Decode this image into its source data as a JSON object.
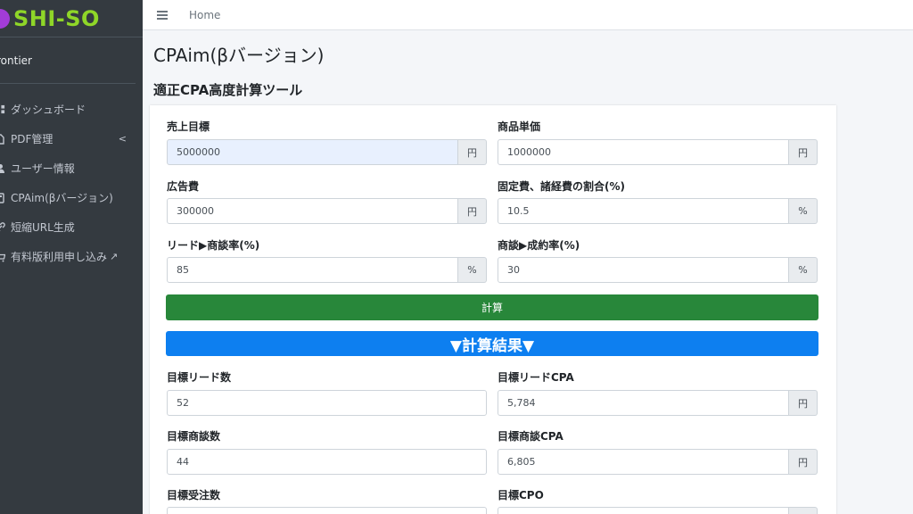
{
  "brand": {
    "name": "SHI-SO"
  },
  "user": {
    "name": "rontier"
  },
  "sidebar": {
    "items": [
      {
        "label": "ダッシュボード",
        "icon": "dashboard-icon"
      },
      {
        "label": "PDF管理",
        "icon": "document-icon",
        "arrow": "<"
      },
      {
        "label": "ユーザー情報",
        "icon": "user-icon"
      },
      {
        "label": "CPAim(βバージョン)",
        "icon": "calculator-icon"
      },
      {
        "label": "短縮URL生成",
        "icon": "link-icon"
      },
      {
        "label": "有料版利用申し込み",
        "icon": "cart-icon",
        "external": "↗"
      }
    ]
  },
  "topbar": {
    "home": "Home"
  },
  "page": {
    "title": "CPAim(βバージョン)",
    "section_title": "適正CPA高度計算ツール"
  },
  "form": {
    "sales_target": {
      "label": "売上目標",
      "value": "5000000",
      "unit": "円"
    },
    "unit_price": {
      "label": "商品単価",
      "value": "1000000",
      "unit": "円"
    },
    "ad_cost": {
      "label": "広告費",
      "value": "300000",
      "unit": "円"
    },
    "fixed_cost_ratio": {
      "label": "固定費、諸経費の割合(%)",
      "value": "10.5",
      "unit": "%"
    },
    "lead_to_meeting": {
      "label": "リード▶商談率(%)",
      "value": "85",
      "unit": "%"
    },
    "meeting_to_contract": {
      "label": "商談▶成約率(%)",
      "value": "30",
      "unit": "%"
    },
    "calc_button": "計算"
  },
  "results": {
    "header": "▼計算結果▼",
    "target_leads": {
      "label": "目標リード数",
      "value": "52"
    },
    "target_lead_cpa": {
      "label": "目標リードCPA",
      "value": "5,784",
      "unit": "円"
    },
    "target_meetings": {
      "label": "目標商談数",
      "value": "44"
    },
    "target_meeting_cpa": {
      "label": "目標商談CPA",
      "value": "6,805",
      "unit": "円"
    },
    "target_orders": {
      "label": "目標受注数"
    },
    "target_cpo": {
      "label": "目標CPO"
    }
  },
  "colors": {
    "sidebar": "#343a40",
    "brand": "#8fd628",
    "logo": "#a23cd8",
    "calc_button": "#28873a",
    "result_header": "#0d7ff0"
  }
}
